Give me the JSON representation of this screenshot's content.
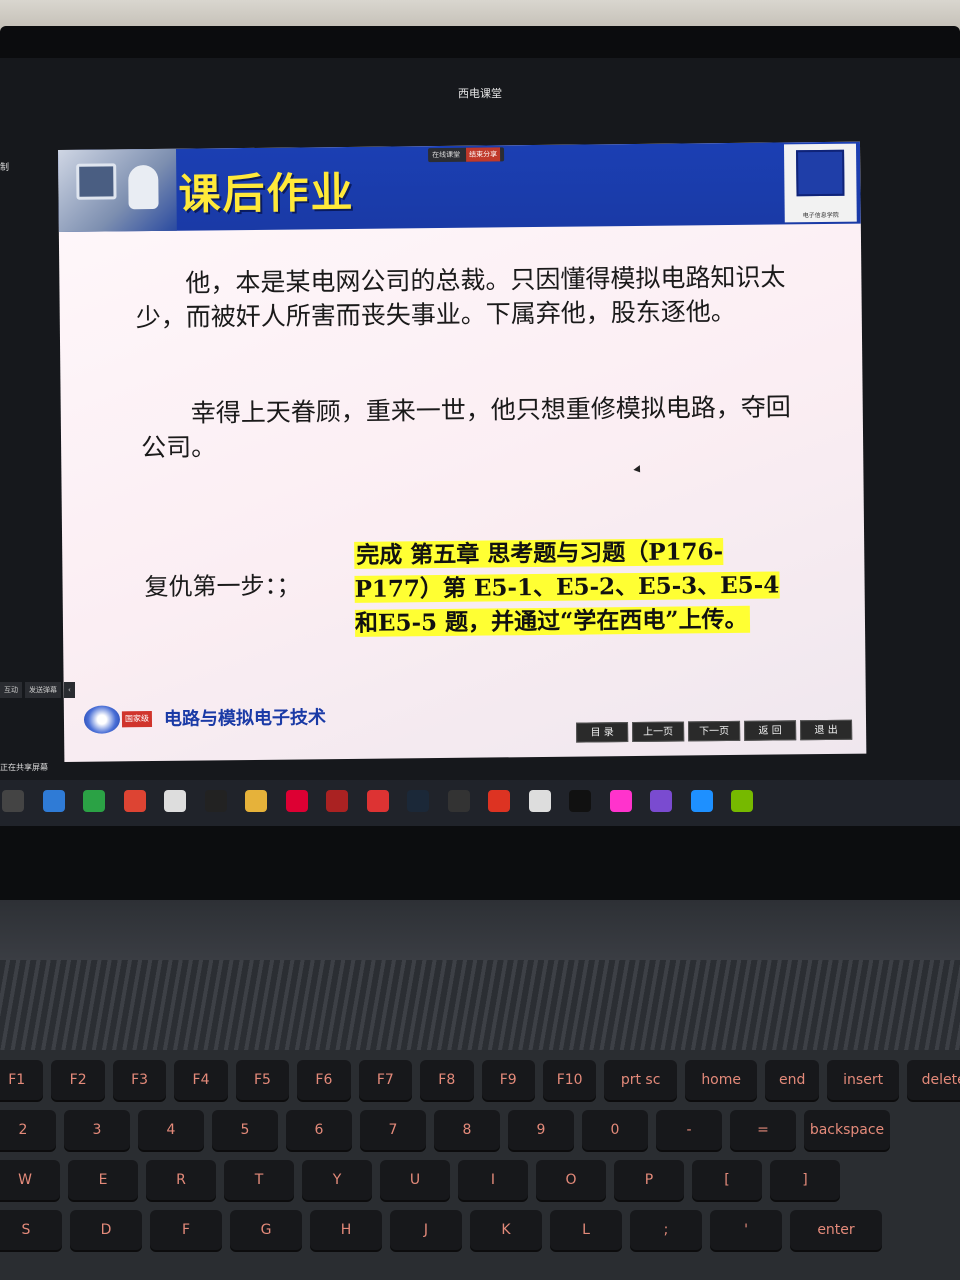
{
  "app": {
    "title": "西电课堂"
  },
  "share_bar": {
    "status": "在线课堂",
    "stop": "结束分享"
  },
  "slide": {
    "title": "课后作业",
    "logo_caption": "电子信息学院",
    "paragraph1": "他，本是某电网公司的总裁。只因懂得模拟电路知识太少，而被奸人所害而丧失事业。下属弃他，股东逐他。",
    "paragraph2": "幸得上天眷顾，重来一世，他只想重修模拟电路，夺回公司。",
    "step_label": "复仇第一步：；",
    "task_plain": "完成 第五章 思考题与习题（P176-P177）第 E5-1、E5-2、E5-3、E5-4和E5-5 题，并通过“学在西电”上传。",
    "course_badge": "国家级",
    "course_name": "电路与模拟电子技术",
    "nav": [
      "目 录",
      "上一页",
      "下一页",
      "返 回",
      "退 出"
    ]
  },
  "left_tools": [
    "互动",
    "发送弹幕"
  ],
  "share_status": "正在共享屏幕",
  "taskbar_icons": [
    "search-icon",
    "edge-icon",
    "wechat-icon",
    "qq-icon",
    "file-icon",
    "g-icon",
    "folder-icon",
    "netease-music-icon",
    "qq-music-icon",
    "ppt-icon",
    "steam-icon",
    "epic-icon",
    "app-icon",
    "edit-icon",
    "capcut-icon",
    "app2-icon",
    "visual-studio-icon",
    "vscode-icon",
    "nvidia-icon"
  ],
  "keyboard": {
    "row1": [
      "F1",
      "F2",
      "F3",
      "F4",
      "F5",
      "F6",
      "F7",
      "F8",
      "F9",
      "F10",
      "prt sc",
      "home",
      "end",
      "insert",
      "delete"
    ],
    "row2": [
      "2",
      "3",
      "4",
      "5",
      "6",
      "7",
      "8",
      "9",
      "0",
      "-",
      "=",
      "backspace"
    ],
    "row3": [
      "W",
      "E",
      "R",
      "T",
      "Y",
      "U",
      "I",
      "O",
      "P",
      "[",
      "]"
    ],
    "row4": [
      "S",
      "D",
      "F",
      "G",
      "H",
      "J",
      "K",
      "L",
      ";",
      "'",
      "enter"
    ]
  }
}
